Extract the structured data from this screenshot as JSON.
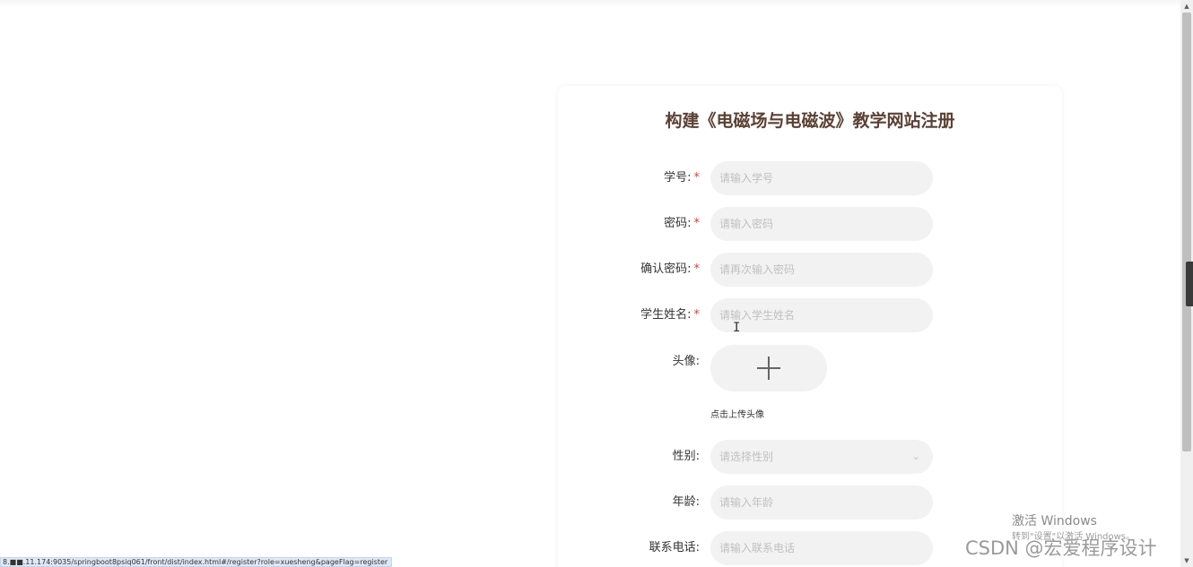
{
  "form": {
    "title": "构建《电磁场与电磁波》教学网站注册",
    "required_mark": "*",
    "fields": {
      "student_id": {
        "label": "学号:",
        "placeholder": "请输入学号"
      },
      "password": {
        "label": "密码:",
        "placeholder": "请输入密码"
      },
      "confirm_password": {
        "label": "确认密码:",
        "placeholder": "请再次输入密码"
      },
      "student_name": {
        "label": "学生姓名:",
        "placeholder": "请输入学生姓名"
      },
      "avatar": {
        "label": "头像:",
        "hint": "点击上传头像"
      },
      "gender": {
        "label": "性别:",
        "placeholder": "请选择性别"
      },
      "age": {
        "label": "年龄:",
        "placeholder": "请输入年龄"
      },
      "phone": {
        "label": "联系电话:",
        "placeholder": "请输入联系电话"
      }
    }
  },
  "status_bar": {
    "url": "8.■■.11.174:9035/springboot8psiq061/front/dist/index.html#/register?role=xuesheng&pageFlag=register"
  },
  "watermarks": {
    "activate_title": "激活 Windows",
    "activate_sub": "转到\"设置\"以激活 Windows。",
    "csdn": "CSDN @宏爱程序设计"
  },
  "icons": {
    "upload": "plus-icon",
    "select": "chevron-down-icon",
    "cursor": "text-cursor-icon"
  },
  "colors": {
    "title": "#5b4134",
    "required": "#e53935",
    "input_bg": "#f2f2f2",
    "placeholder": "#c0c0c0"
  }
}
